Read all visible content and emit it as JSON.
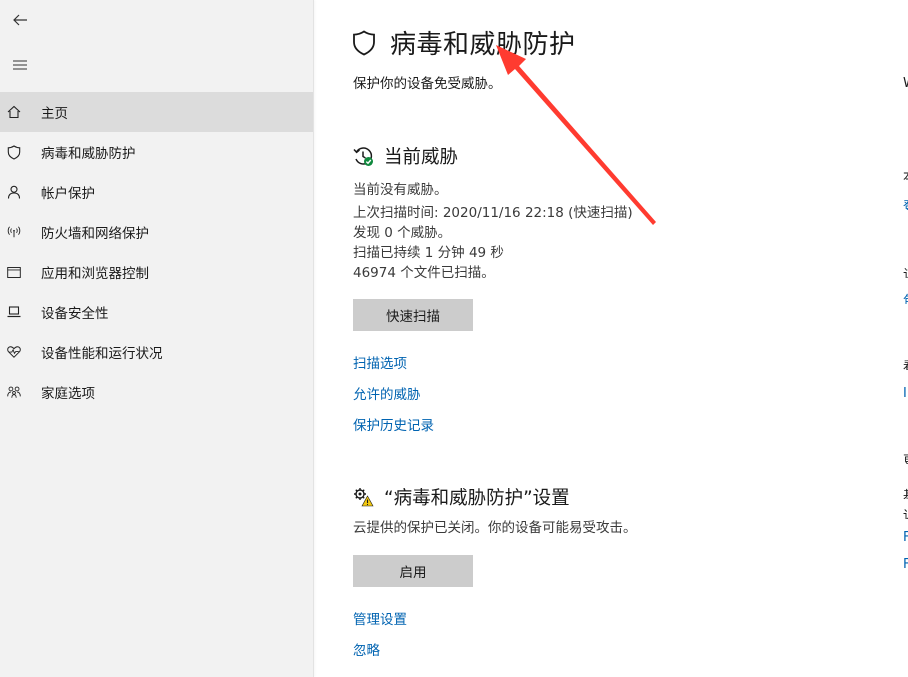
{
  "sidebar": {
    "back_icon": "back-arrow-icon",
    "menu_icon": "hamburger-menu-icon",
    "items": [
      {
        "label": "主页",
        "icon": "home-icon",
        "active": true
      },
      {
        "label": "病毒和威胁防护",
        "icon": "shield-icon",
        "active": false
      },
      {
        "label": "帐户保护",
        "icon": "person-icon",
        "active": false
      },
      {
        "label": "防火墙和网络保护",
        "icon": "wifi-signal-icon",
        "active": false
      },
      {
        "label": "应用和浏览器控制",
        "icon": "browser-window-icon",
        "active": false
      },
      {
        "label": "设备安全性",
        "icon": "laptop-icon",
        "active": false
      },
      {
        "label": "设备性能和运行状况",
        "icon": "heart-pulse-icon",
        "active": false
      },
      {
        "label": "家庭选项",
        "icon": "family-icon",
        "active": false
      }
    ]
  },
  "main": {
    "title": "病毒和威胁防护",
    "subtitle": "保护你的设备免受威胁。",
    "current_threats": {
      "title": "当前威胁",
      "status": "当前没有威胁。",
      "last_scan": "上次扫描时间: 2020/11/16 22:18 (快速扫描)",
      "found": "发现 0 个威胁。",
      "duration": "扫描已持续 1 分钟 49 秒",
      "files": "46974 个文件已扫描。",
      "quick_scan_button": "快速扫描",
      "links": [
        "扫描选项",
        "允许的威胁",
        "保护历史记录"
      ]
    },
    "settings": {
      "title": "“病毒和威胁防护”设置",
      "description": "云提供的保护已关闭。你的设备可能易受攻击。",
      "enable_button": "启用",
      "links": [
        "管理设置",
        "忽略"
      ]
    }
  },
  "right_edge": {
    "fragments": [
      "W",
      "本",
      "登",
      "该",
      "包",
      "看",
      "I",
      "更",
      "基",
      "详",
      "F",
      "F"
    ]
  },
  "colors": {
    "accent": "#0063b1",
    "sidebar_bg": "#f2f2f2",
    "active_item_bg": "#dcdcdc",
    "button_bg": "#cccccc",
    "annotation": "#ff3b30",
    "status_ok": "#10893e",
    "warning": "#f2c811"
  }
}
